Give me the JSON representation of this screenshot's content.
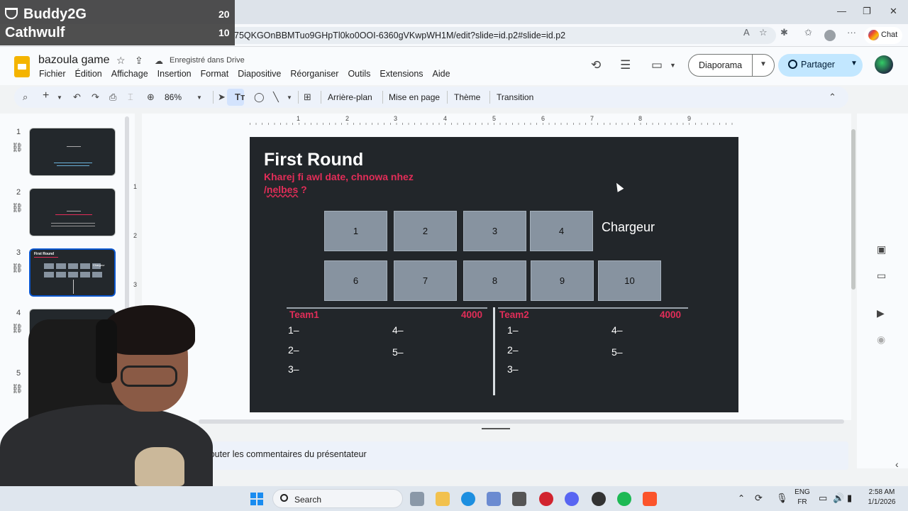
{
  "overlay": {
    "players": [
      {
        "name": "Buddy2G",
        "score": "20"
      },
      {
        "name": "Cathwulf",
        "score": "10"
      }
    ]
  },
  "browser": {
    "url": "75QKGOnBBMTuo9GHpTl0ko0OOI-6360gVKwpWH1M/edit?slide=id.p2#slide=id.p2",
    "chat_label": "Chat",
    "window_controls": [
      "minimize-icon",
      "restore-icon",
      "close-icon"
    ]
  },
  "app": {
    "doc_title": "bazoula game",
    "save_status": "Enregistré dans Drive",
    "menu": [
      "Fichier",
      "Édition",
      "Affichage",
      "Insertion",
      "Format",
      "Diapositive",
      "Réorganiser",
      "Outils",
      "Extensions",
      "Aide"
    ],
    "slideshow_label": "Diaporama",
    "share_label": "Partager"
  },
  "toolbar": {
    "zoom": "86%",
    "background_label": "Arrière-plan",
    "layout_label": "Mise en page",
    "theme_label": "Thème",
    "transition_label": "Transition"
  },
  "ruler": {
    "top": [
      "1",
      "2",
      "3",
      "4",
      "5",
      "6",
      "7",
      "8",
      "9"
    ],
    "left": [
      "1",
      "2",
      "3"
    ]
  },
  "filmstrip": {
    "slides": [
      "1",
      "2",
      "3",
      "4",
      "5"
    ],
    "active": "3",
    "thumb3_title": "First Round",
    "thumb3_chargeur": "Chargeur"
  },
  "slide": {
    "title": "First Round",
    "subtitle_part1": "Kharej fi awl date, chnowa nhez /",
    "subtitle_part2": "nelbes",
    "subtitle_part3": " ?",
    "boxes_row1": [
      "1",
      "2",
      "3",
      "4"
    ],
    "boxes_row2": [
      "6",
      "7",
      "8",
      "9",
      "10"
    ],
    "chargeur": "Chargeur",
    "team1": {
      "name": "Team1",
      "points": "4000",
      "slots": [
        "1–",
        "2–",
        "3–",
        "4–",
        "5–"
      ]
    },
    "team2": {
      "name": "Team2",
      "points": "4000",
      "slots": [
        "1–",
        "2–",
        "3–",
        "4–",
        "5–"
      ]
    }
  },
  "notes": {
    "placeholder": "ajouter les commentaires du présentateur"
  },
  "taskbar": {
    "search_label": "Search",
    "lang_top": "ENG",
    "lang_bottom": "FR",
    "time": "2:58 AM",
    "date": "1/1/2026"
  },
  "colors": {
    "slide_bg": "#22262a",
    "accent_red": "#e22d58",
    "box_fill": "#8793a0",
    "share_button": "#c2e7ff"
  }
}
